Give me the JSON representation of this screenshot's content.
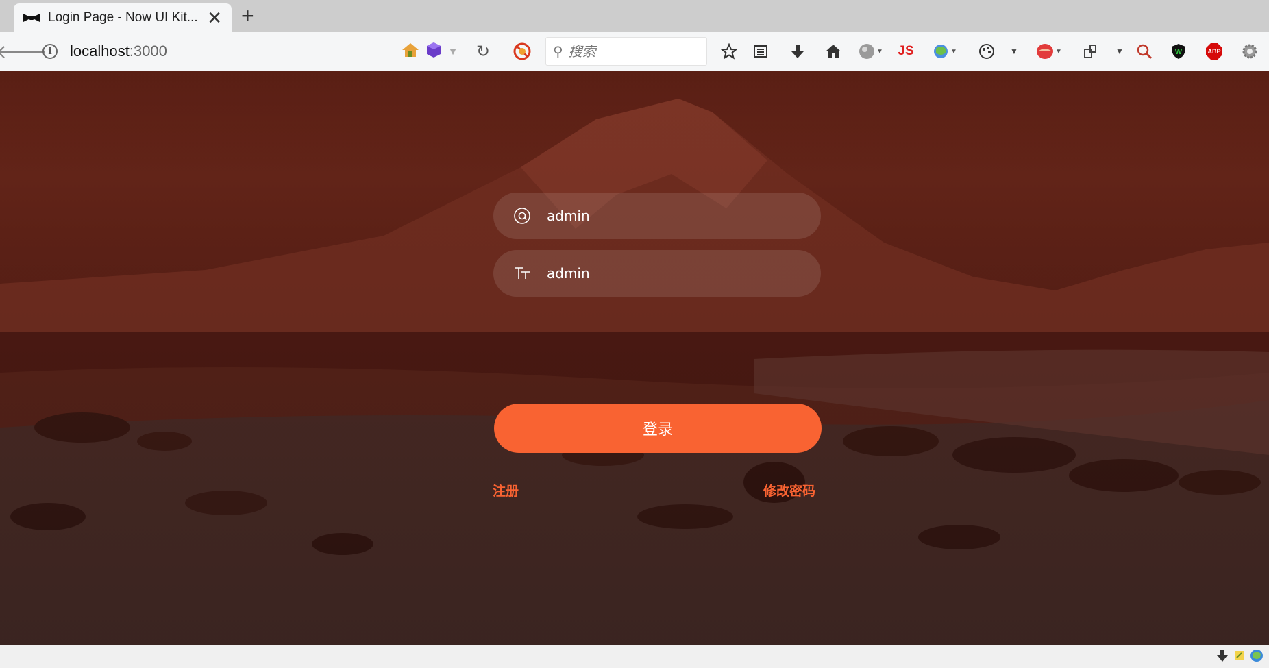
{
  "browser": {
    "tab_title": "Login Page - Now UI Kit...",
    "url_host": "localhost",
    "url_port": ":3000",
    "search_placeholder": "搜索",
    "js_label": "JS",
    "abp_label": "ABP"
  },
  "login": {
    "username_value": "admin",
    "password_value": "admin",
    "submit_label": "登录",
    "register_link": "注册",
    "change_password_link": "修改密码"
  },
  "colors": {
    "accent": "#f96332",
    "tab_bar": "#cdcdcd",
    "toolbar": "#f5f6f7"
  },
  "icons": {
    "username": "at-sign-icon",
    "password": "text-size-icon"
  }
}
